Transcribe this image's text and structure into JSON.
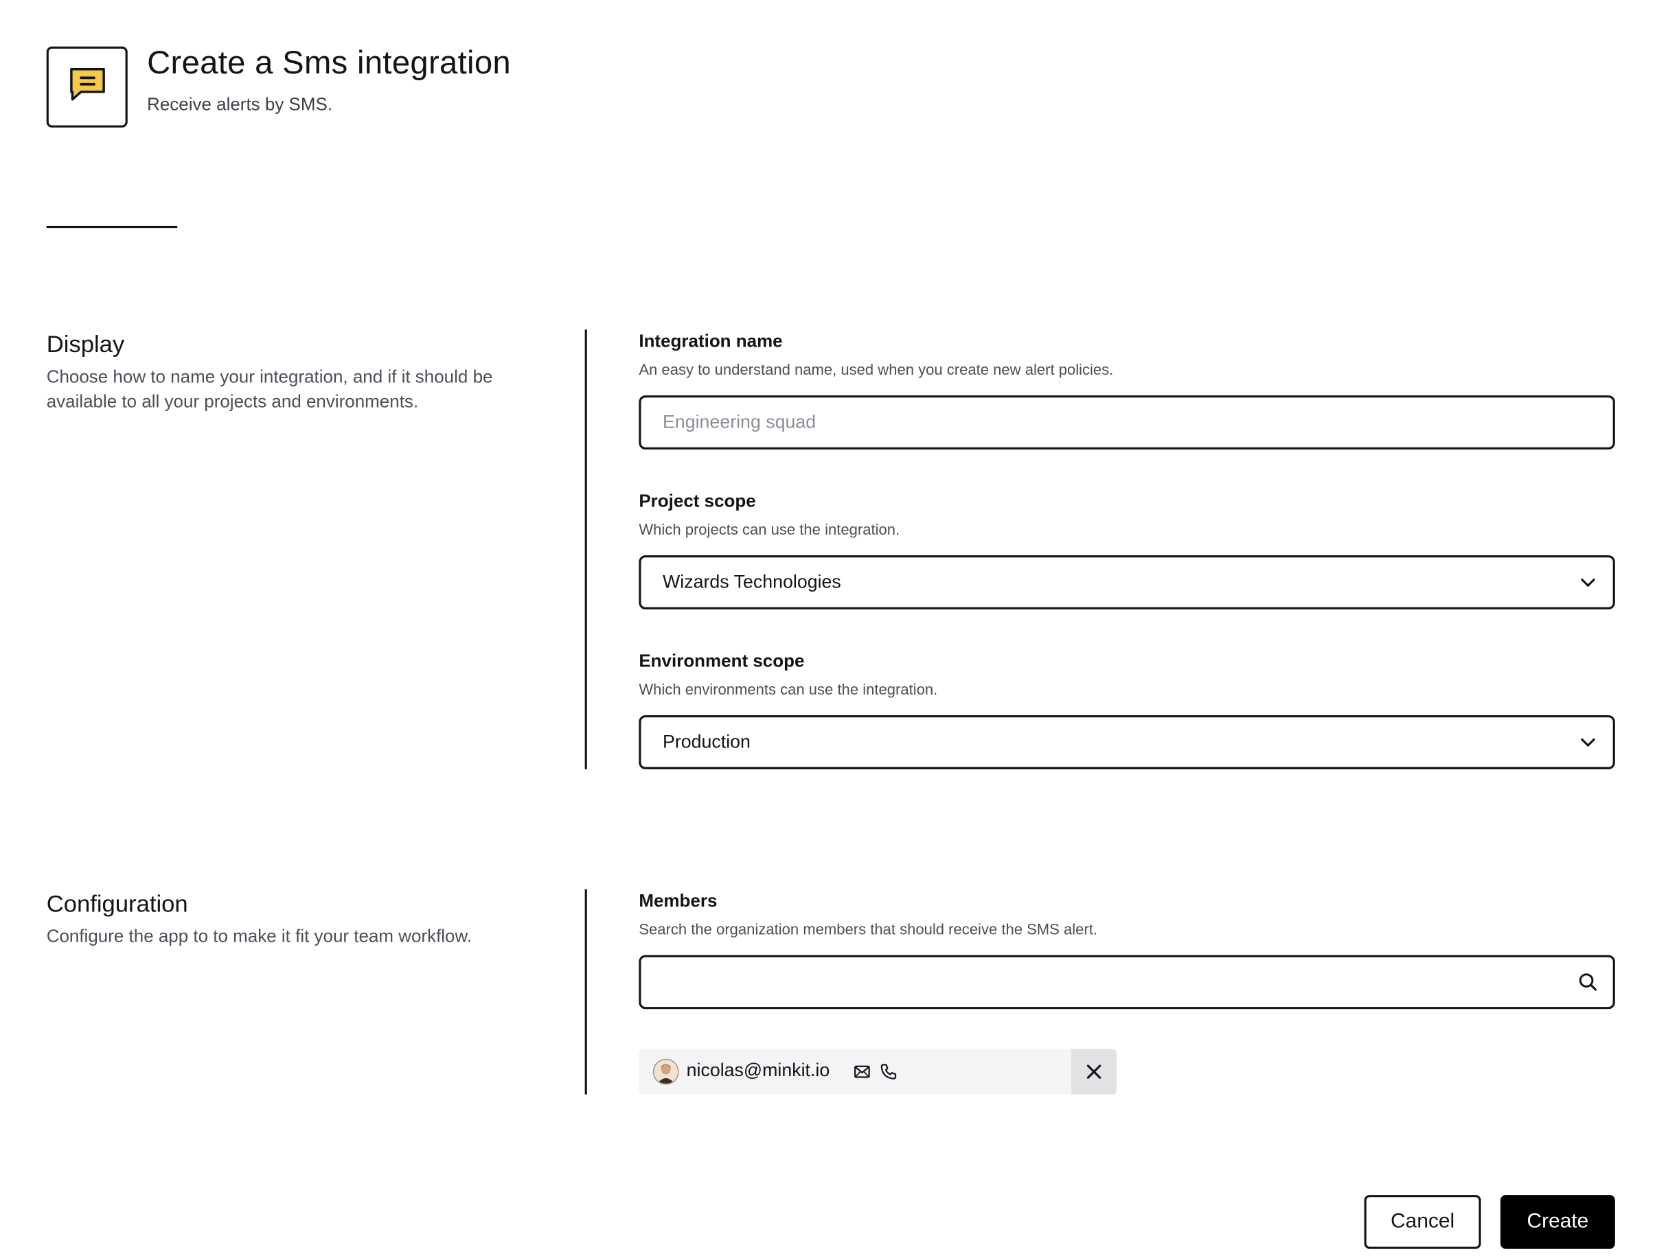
{
  "header": {
    "icon": "chat-message-icon",
    "icon_color": "#F8C84A",
    "title": "Create a Sms integration",
    "subtitle": "Receive alerts by SMS."
  },
  "display_section": {
    "title": "Display",
    "description": "Choose how to name your integration, and if it should be available to all your projects and environments.",
    "integration_name": {
      "label": "Integration name",
      "help": "An easy to understand name, used when you create new alert policies.",
      "placeholder": "Engineering squad",
      "value": ""
    },
    "project_scope": {
      "label": "Project scope",
      "help": "Which projects can use the integration.",
      "selected": "Wizards Technologies"
    },
    "environment_scope": {
      "label": "Environment scope",
      "help": "Which environments can use the integration.",
      "selected": "Production"
    }
  },
  "configuration_section": {
    "title": "Configuration",
    "description": "Configure the app to to make it fit your team workflow.",
    "members": {
      "label": "Members",
      "help": "Search the organization members that should receive the SMS alert.",
      "search_value": "",
      "selected": [
        {
          "email": "nicolas@minkit.io",
          "icons": [
            "mail-icon",
            "phone-icon"
          ]
        }
      ]
    }
  },
  "actions": {
    "cancel_label": "Cancel",
    "create_label": "Create"
  }
}
